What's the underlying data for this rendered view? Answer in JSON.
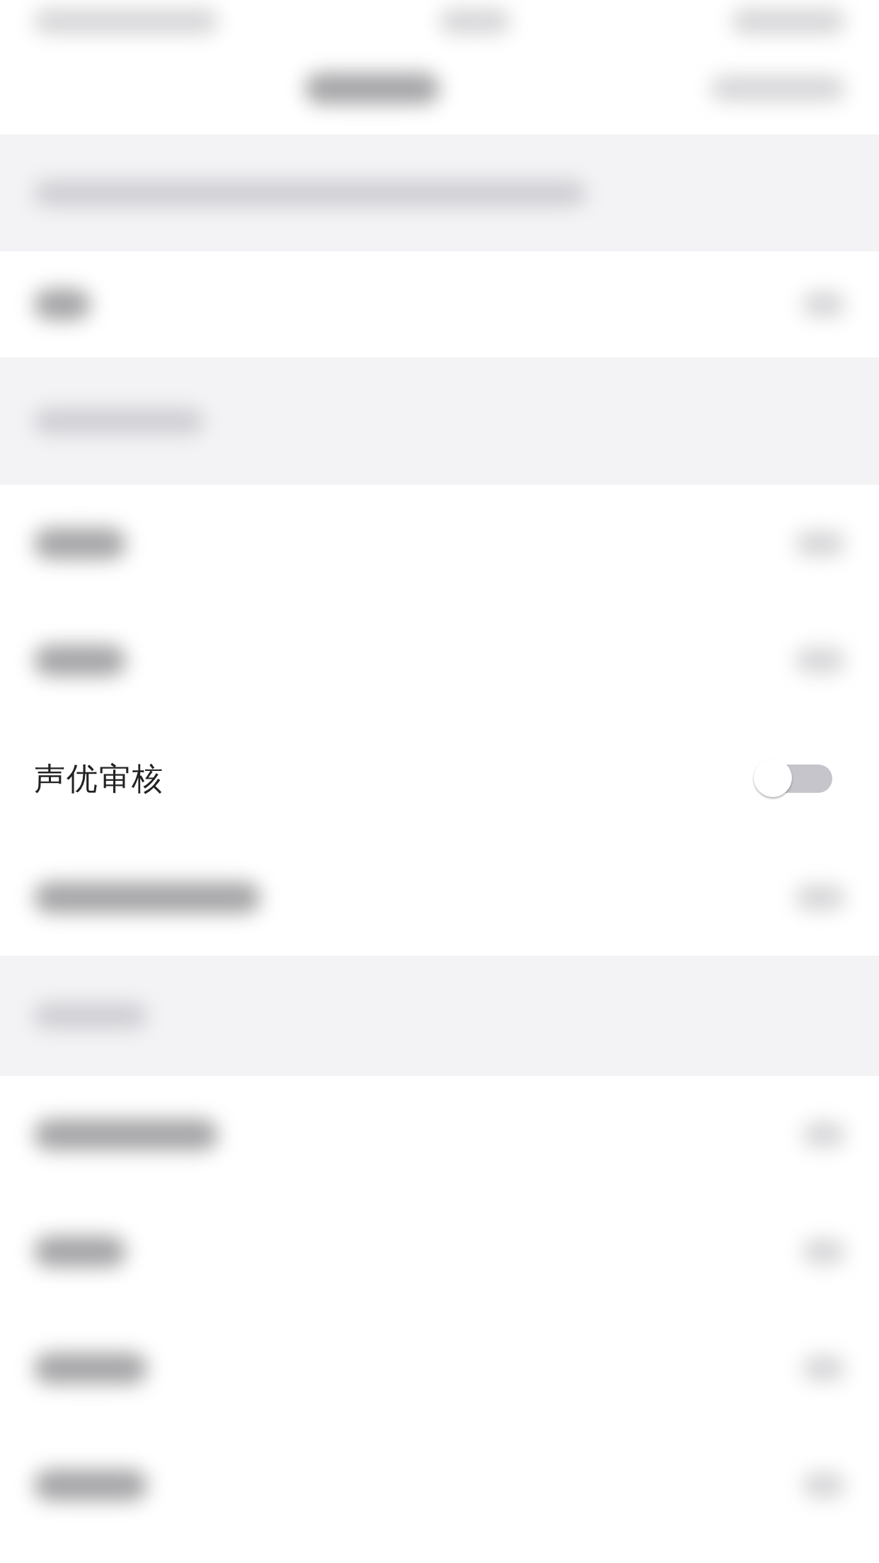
{
  "setting": {
    "label": "声优审核",
    "on": false
  }
}
